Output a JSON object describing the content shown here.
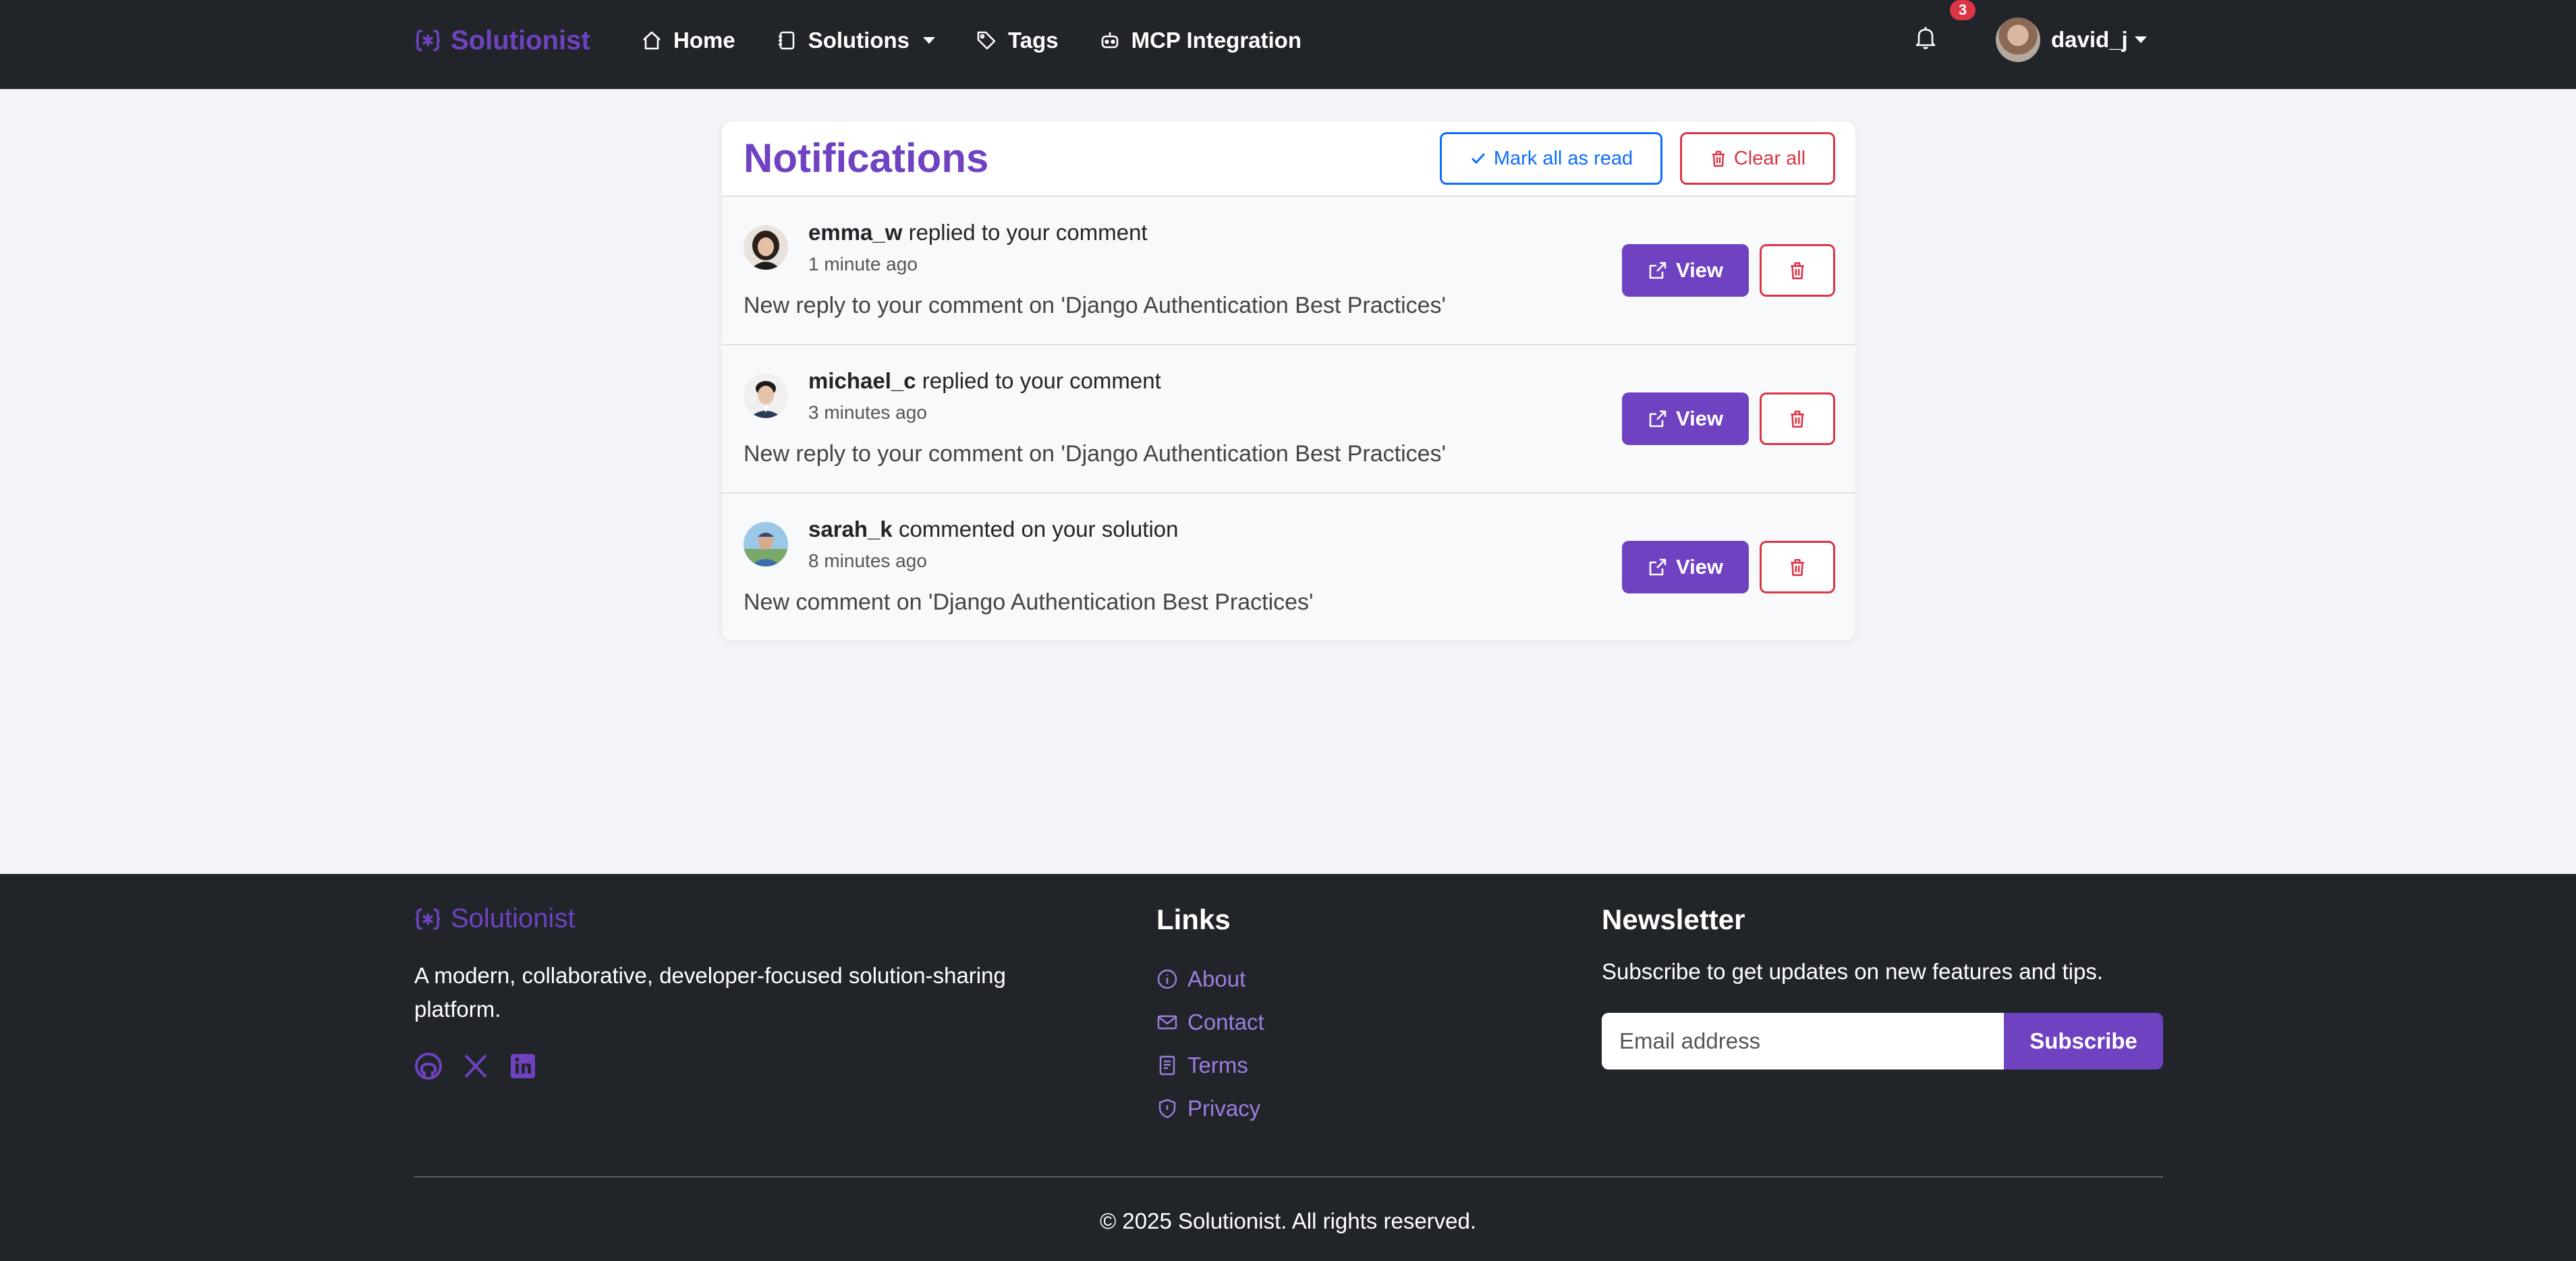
{
  "navbar": {
    "brand": "Solutionist",
    "links": [
      {
        "label": "Home",
        "icon": "home-icon"
      },
      {
        "label": "Solutions",
        "icon": "journal-icon",
        "dropdown": true
      },
      {
        "label": "Tags",
        "icon": "tag-icon"
      },
      {
        "label": "MCP Integration",
        "icon": "robot-icon"
      }
    ],
    "notification_count": "3",
    "username": "david_j"
  },
  "notifications": {
    "title": "Notifications",
    "mark_all_label": "Mark all as read",
    "clear_all_label": "Clear all",
    "view_label": "View",
    "items": [
      {
        "user": "emma_w",
        "action": "replied to your comment",
        "time": "1 minute ago",
        "message": "New reply to your comment on 'Django Authentication Best Practices'"
      },
      {
        "user": "michael_c",
        "action": "replied to your comment",
        "time": "3 minutes ago",
        "message": "New reply to your comment on 'Django Authentication Best Practices'"
      },
      {
        "user": "sarah_k",
        "action": "commented on your solution",
        "time": "8 minutes ago",
        "message": "New comment on 'Django Authentication Best Practices'"
      }
    ]
  },
  "footer": {
    "brand": "Solutionist",
    "description": "A modern, collaborative, developer-focused solution-sharing platform.",
    "social": [
      "github-icon",
      "x-icon",
      "linkedin-icon"
    ],
    "links_heading": "Links",
    "links": [
      {
        "label": "About",
        "icon": "info-icon"
      },
      {
        "label": "Contact",
        "icon": "envelope-icon"
      },
      {
        "label": "Terms",
        "icon": "document-icon"
      },
      {
        "label": "Privacy",
        "icon": "shield-icon"
      }
    ],
    "newsletter_heading": "Newsletter",
    "newsletter_text": "Subscribe to get updates on new features and tips.",
    "email_placeholder": "Email address",
    "subscribe_label": "Subscribe",
    "copyright": "© 2025 Solutionist. All rights reserved."
  },
  "colors": {
    "brand": "#6f42c1",
    "navbar_bg": "#212529",
    "danger": "#dc3545",
    "primary": "#0d6efd",
    "page_bg": "#f4f3f8"
  }
}
